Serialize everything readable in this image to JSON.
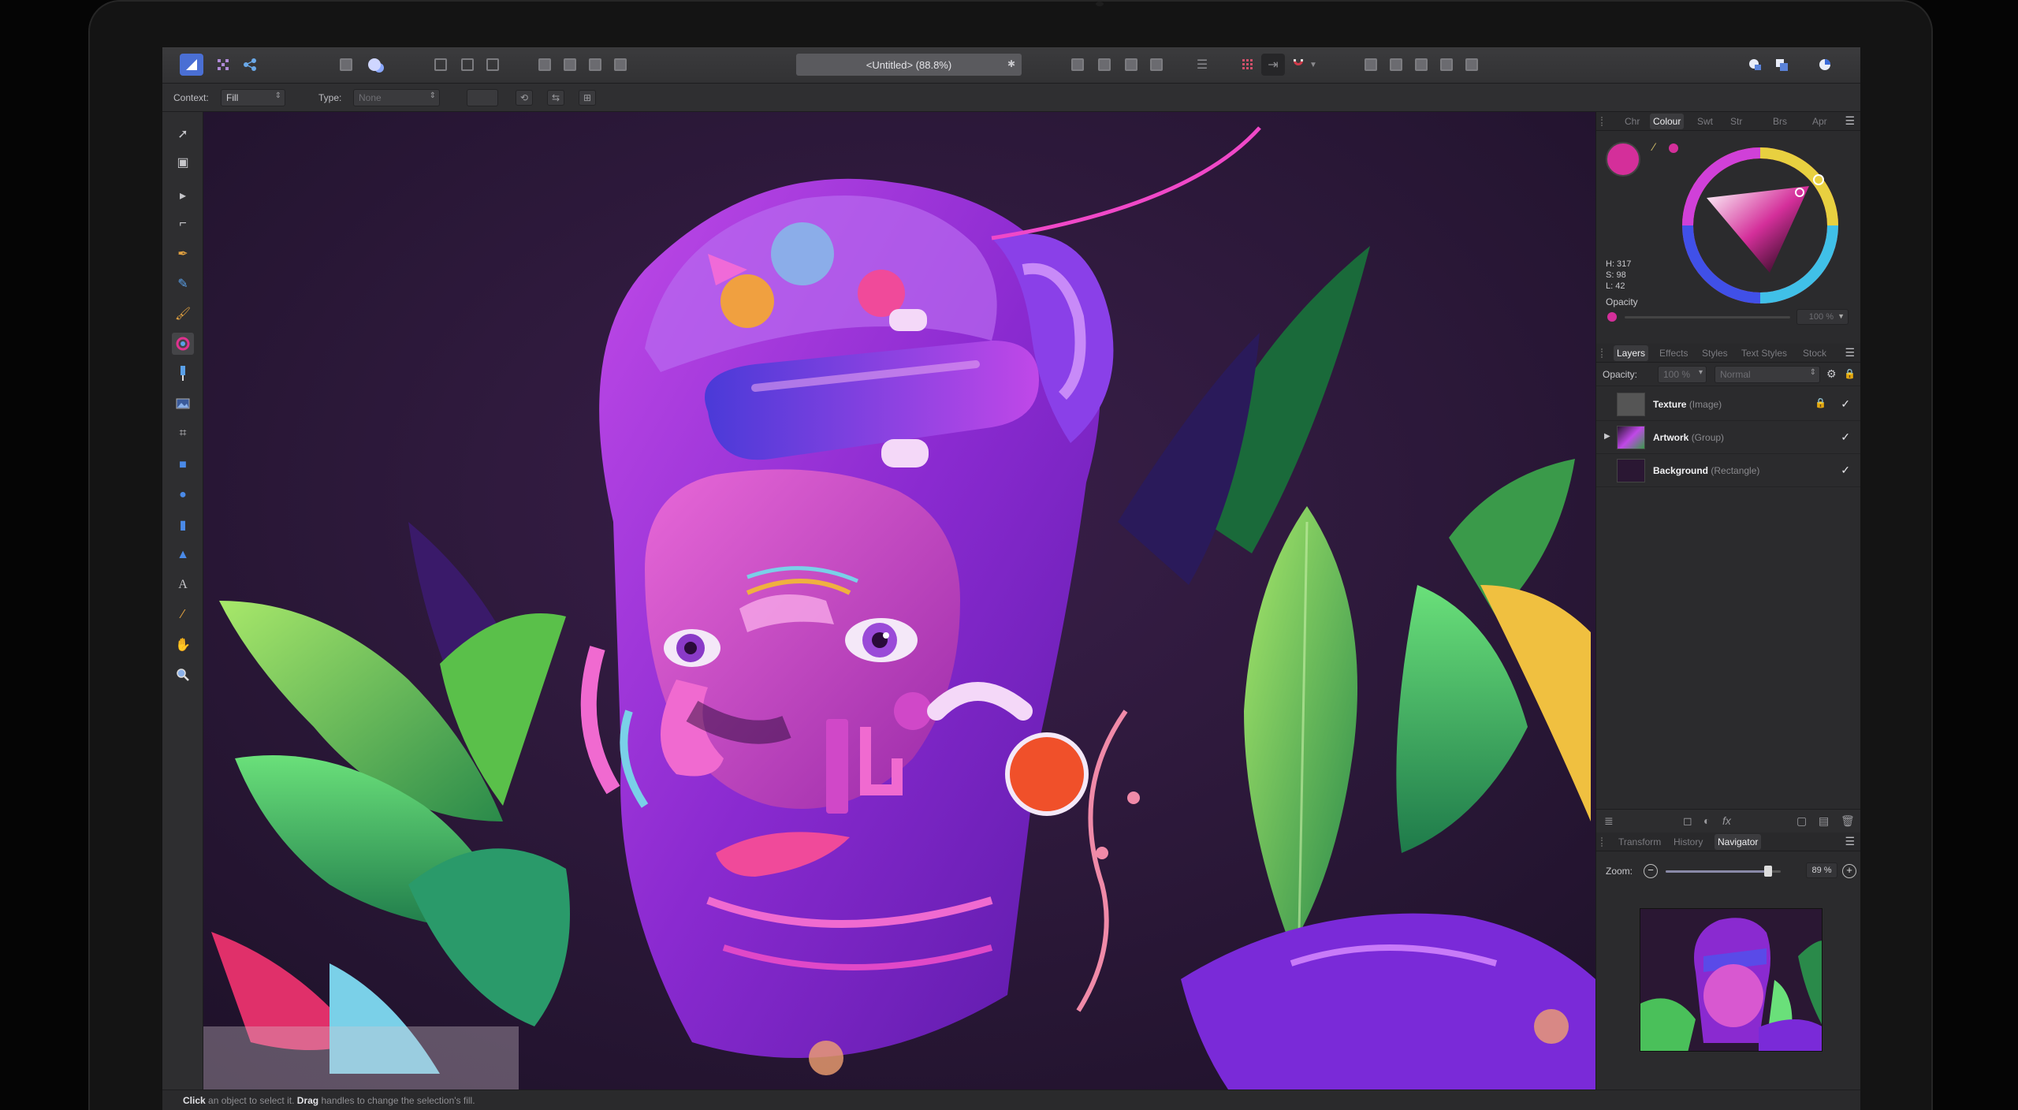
{
  "document": {
    "title": "<Untitled> (88.8%)"
  },
  "context_toolbar": {
    "context_label": "Context:",
    "context_value": "Fill",
    "type_label": "Type:",
    "type_value": "None"
  },
  "colour_panel": {
    "tabs": [
      "Chr",
      "Colour",
      "Swt",
      "Str",
      "Brs",
      "Apr"
    ],
    "active_tab": "Colour",
    "current_colour": "#d42f9a",
    "hue_text": "H: 317",
    "sat_text": "S: 98",
    "light_text": "L: 42",
    "opacity_label": "Opacity",
    "opacity_value": "100 %",
    "opacity_percent": 100
  },
  "layers_panel": {
    "tabs": [
      "Layers",
      "Effects",
      "Styles",
      "Text Styles",
      "Stock"
    ],
    "active_tab": "Layers",
    "opacity_label": "Opacity:",
    "opacity_value": "100 %",
    "blend_mode": "Normal",
    "layers": [
      {
        "name": "Texture",
        "type": "(Image)",
        "locked": true,
        "visible": true,
        "expandable": false
      },
      {
        "name": "Artwork",
        "type": "(Group)",
        "locked": false,
        "visible": true,
        "expandable": true
      },
      {
        "name": "Background",
        "type": "(Rectangle)",
        "locked": false,
        "visible": true,
        "expandable": false
      }
    ]
  },
  "navigator_panel": {
    "tabs": [
      "Transform",
      "History",
      "Navigator"
    ],
    "active_tab": "Navigator",
    "zoom_label": "Zoom:",
    "zoom_value": "89 %",
    "zoom_percent": 89
  },
  "status_bar": {
    "click_word": "Click",
    "click_text": "an object to select it.",
    "drag_word": "Drag",
    "drag_text": "handles to change the selection's fill."
  },
  "colors": {
    "accent": "#4a6fd4",
    "selected_colour": "#d42f9a"
  }
}
